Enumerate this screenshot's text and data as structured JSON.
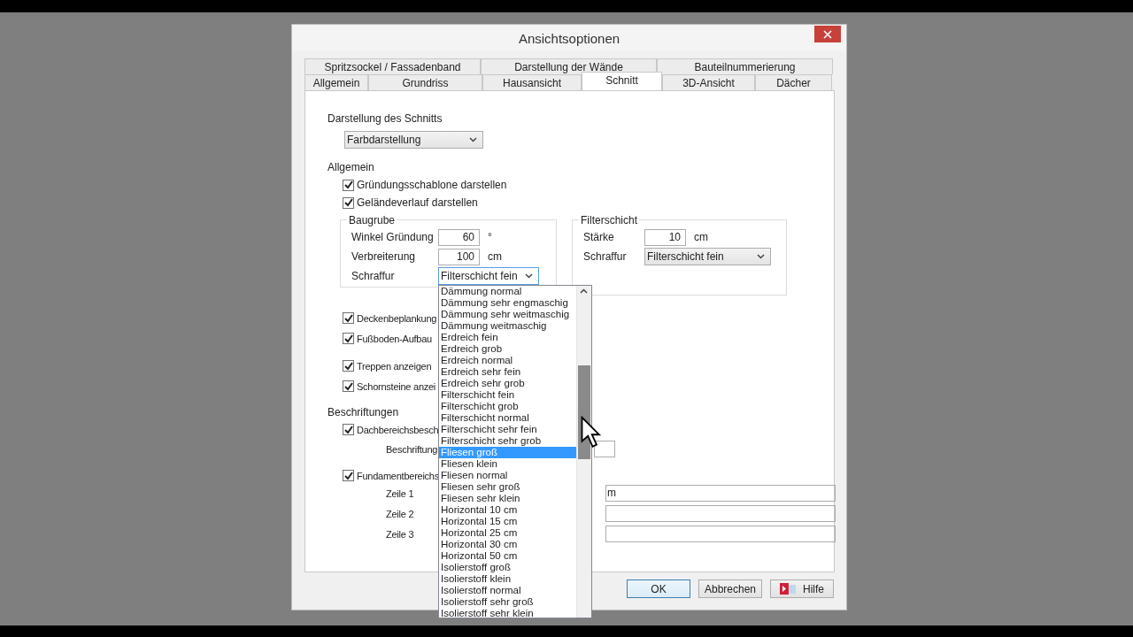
{
  "window": {
    "title": "Ansichtsoptionen"
  },
  "tab_rows": [
    [
      {
        "label": "Spritzsockel / Fassadenband",
        "selected": false
      },
      {
        "label": "Darstellung der Wände",
        "selected": false
      },
      {
        "label": "Bauteilnummerierung",
        "selected": false
      }
    ],
    [
      {
        "label": "Allgemein",
        "selected": false
      },
      {
        "label": "Grundriss",
        "selected": false
      },
      {
        "label": "Hausansicht",
        "selected": false
      },
      {
        "label": "Schnitt",
        "selected": true
      },
      {
        "label": "3D-Ansicht",
        "selected": false
      },
      {
        "label": "Dächer",
        "selected": false
      }
    ]
  ],
  "section_display": {
    "label": "Darstellung des Schnitts",
    "value": "Farbdarstellung"
  },
  "general": {
    "label": "Allgemein",
    "checkboxes": [
      {
        "label": "Gründungsschablone darstellen",
        "checked": true
      },
      {
        "label": "Geländeverlauf darstellen",
        "checked": true
      }
    ]
  },
  "baugrube": {
    "title": "Baugrube",
    "rows": [
      {
        "label": "Winkel Gründung",
        "value": "60",
        "unit": "°"
      },
      {
        "label": "Verbreiterung",
        "value": "100",
        "unit": "cm"
      }
    ],
    "hatch": {
      "label": "Schraffur",
      "value": "Filterschicht fein",
      "expanded": true
    }
  },
  "filterschicht": {
    "title": "Filterschicht",
    "rows": [
      {
        "label": "Stärke",
        "value": "10",
        "unit": "cm"
      }
    ],
    "hatch": {
      "label": "Schraffur",
      "value": "Filterschicht fein",
      "expanded": false
    }
  },
  "display_groups": [
    [
      {
        "label": "Deckenbeplankung",
        "checked": true
      },
      {
        "label": "Fußboden-Aufbau",
        "checked": true
      }
    ],
    [
      {
        "label": "Treppen anzeigen",
        "checked": true
      },
      {
        "label": "Schornsteine anzei",
        "checked": true
      }
    ]
  ],
  "labels": {
    "title": "Beschriftungen",
    "roof": {
      "label": "Dachbereichsbesch",
      "checked": true
    },
    "roof_field_label": "Beschriftung",
    "foundation": {
      "label": "Fundamentbereichs",
      "checked": true
    },
    "lines": [
      {
        "label": "Zeile 1",
        "value": "m"
      },
      {
        "label": "Zeile 2"
      },
      {
        "label": "Zeile 3"
      }
    ]
  },
  "hatch_list": [
    {
      "label": "Dämmung normal",
      "selected": false
    },
    {
      "label": "Dämmung sehr engmaschig",
      "selected": false
    },
    {
      "label": "Dämmung sehr weitmaschig",
      "selected": false
    },
    {
      "label": "Dämmung weitmaschig",
      "selected": false
    },
    {
      "label": "Erdreich fein",
      "selected": false
    },
    {
      "label": "Erdreich grob",
      "selected": false
    },
    {
      "label": "Erdreich normal",
      "selected": false
    },
    {
      "label": "Erdreich sehr fein",
      "selected": false
    },
    {
      "label": "Erdreich sehr grob",
      "selected": false
    },
    {
      "label": "Filterschicht fein",
      "selected": false
    },
    {
      "label": "Filterschicht grob",
      "selected": false
    },
    {
      "label": "Filterschicht normal",
      "selected": false
    },
    {
      "label": "Filterschicht sehr fein",
      "selected": false
    },
    {
      "label": "Filterschicht sehr grob",
      "selected": false
    },
    {
      "label": "Fliesen groß",
      "selected": true
    },
    {
      "label": "Fliesen klein",
      "selected": false
    },
    {
      "label": "Fliesen normal",
      "selected": false
    },
    {
      "label": "Fliesen sehr groß",
      "selected": false
    },
    {
      "label": "Fliesen sehr klein",
      "selected": false
    },
    {
      "label": "Horizontal 10 cm",
      "selected": false
    },
    {
      "label": "Horizontal 15 cm",
      "selected": false
    },
    {
      "label": "Horizontal 25 cm",
      "selected": false
    },
    {
      "label": "Horizontal 30 cm",
      "selected": false
    },
    {
      "label": "Horizontal 50 cm",
      "selected": false
    },
    {
      "label": "Isolierstoff groß",
      "selected": false
    },
    {
      "label": "Isolierstoff klein",
      "selected": false
    },
    {
      "label": "Isolierstoff normal",
      "selected": false
    },
    {
      "label": "Isolierstoff sehr groß",
      "selected": false
    },
    {
      "label": "Isolierstoff sehr klein",
      "selected": false
    }
  ],
  "buttons": [
    {
      "label": "OK",
      "kind": "default"
    },
    {
      "label": "Abbrechen",
      "kind": "plain"
    },
    {
      "label": "Hilfe",
      "kind": "help"
    }
  ]
}
